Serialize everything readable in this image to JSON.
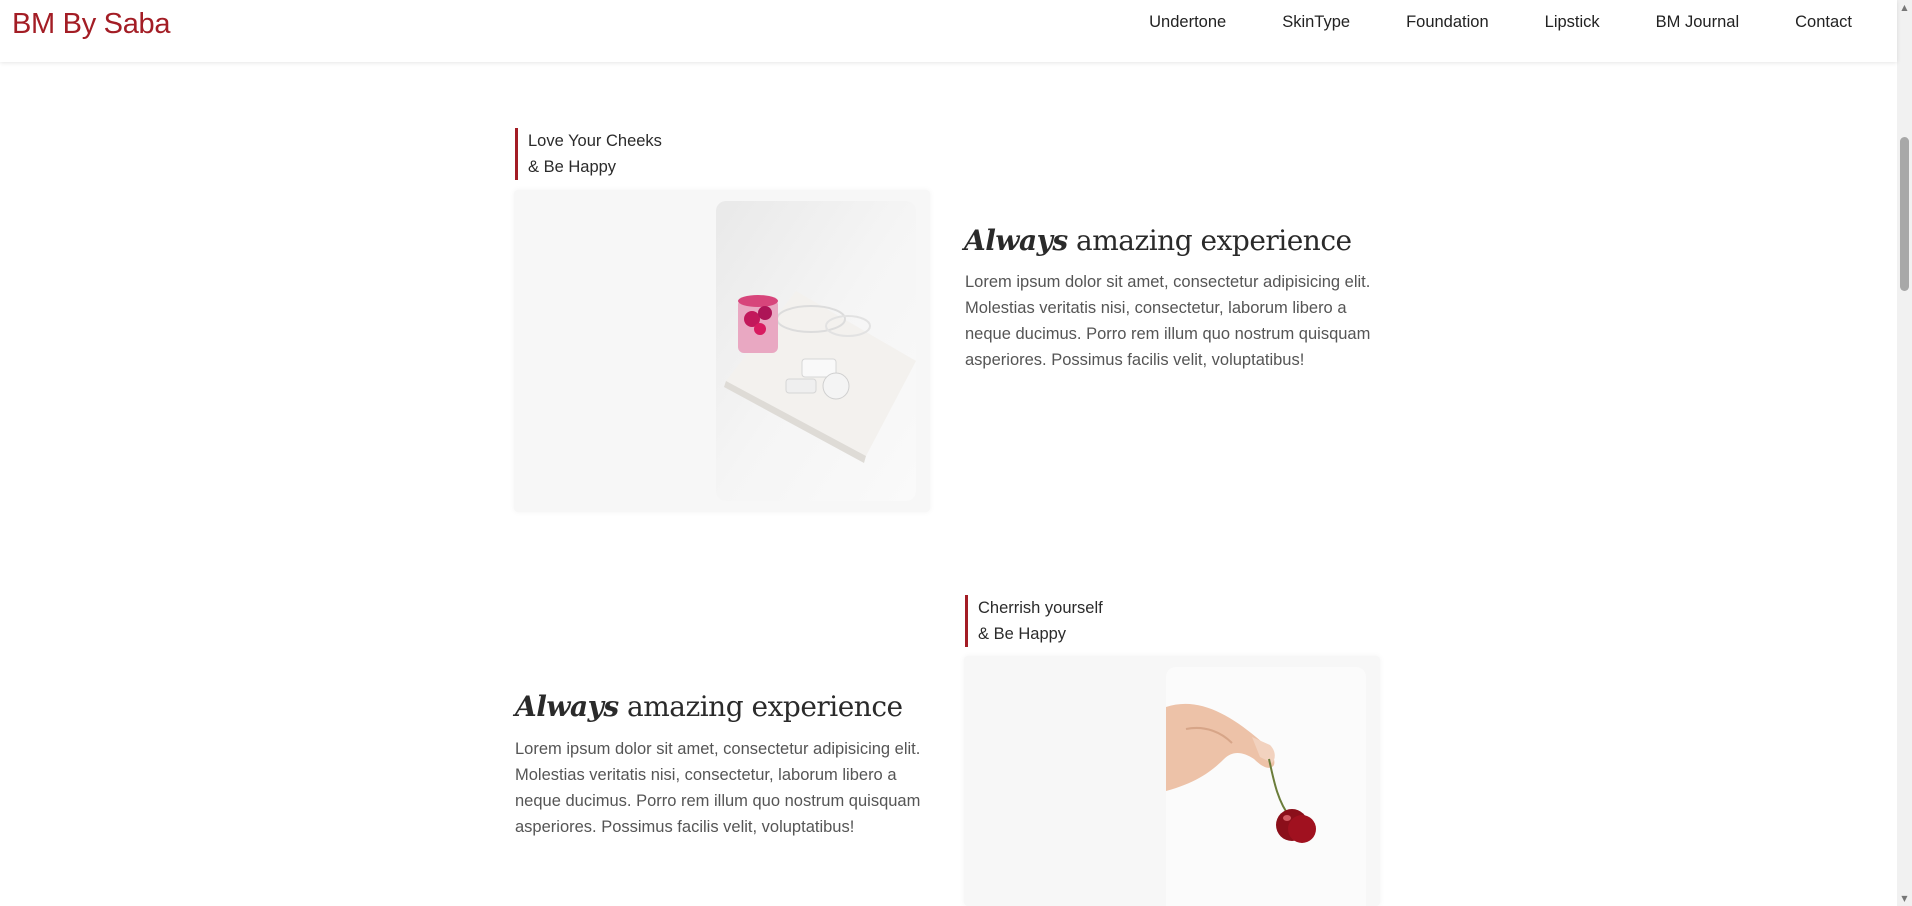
{
  "header": {
    "brand": "BM By Saba",
    "nav": [
      {
        "label": "Undertone"
      },
      {
        "label": "SkinType"
      },
      {
        "label": "Foundation"
      },
      {
        "label": "Lipstick"
      },
      {
        "label": "BM Journal"
      },
      {
        "label": "Contact"
      }
    ]
  },
  "sections": [
    {
      "tag_line1": "Love Your Cheeks",
      "tag_line2": "& Be Happy",
      "heading_em": "Always",
      "heading_rest": " amazing experience",
      "body": "Lorem ipsum dolor sit amet, consectetur adipisicing elit. Molestias veritatis nisi, consectetur, laborum libero a neque ducimus. Porro rem illum quo nostrum quisquam asperiores. Possimus facilis velit, voluptatibus!",
      "image_icon": "pink-drink-tray-photo"
    },
    {
      "tag_line1": "Cherrish yourself",
      "tag_line2": "& Be Happy",
      "heading_em": "Always",
      "heading_rest": " amazing experience",
      "body": "Lorem ipsum dolor sit amet, consectetur adipisicing elit. Molestias veritatis nisi, consectetur, laborum libero a neque ducimus. Porro rem illum quo nostrum quisquam asperiores. Possimus facilis velit, voluptatibus!",
      "image_icon": "hand-cherry-photo"
    }
  ],
  "colors": {
    "brand": "#a31d25",
    "accent_bar": "#a31d25",
    "card_bg": "#f7f7f7"
  }
}
